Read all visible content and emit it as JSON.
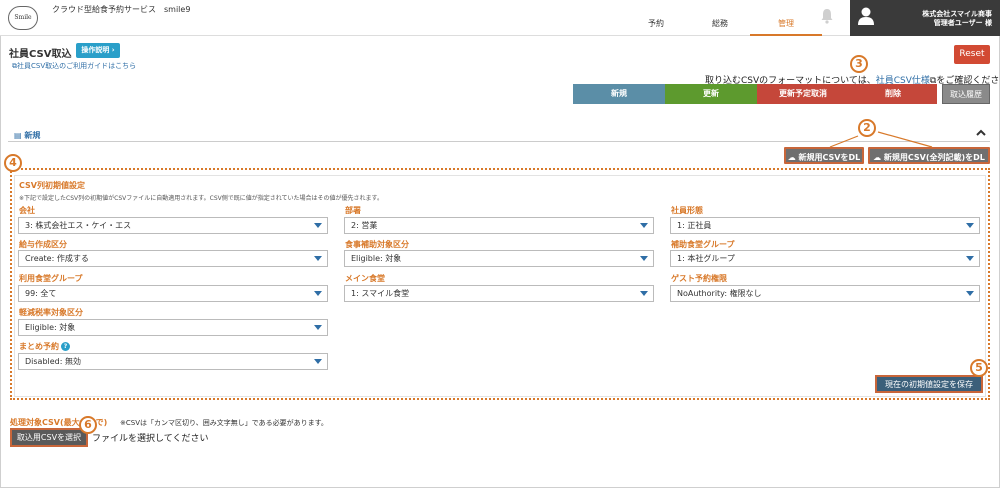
{
  "header": {
    "logo_text": "Smile",
    "service_title": "クラウド型給食予約サービス　smile9",
    "nav": [
      {
        "label": "予約"
      },
      {
        "label": "総務"
      },
      {
        "label": "管理"
      }
    ],
    "company_name": "株式会社スマイル商事",
    "user_name": "管理者ユーザー 様"
  },
  "page": {
    "title": "社員CSV取込",
    "guide_button": "操作説明 ›",
    "guide_link": "社員CSV取込のご利用ガイドはこちら",
    "reset_button": "Reset",
    "format_note_before": "取り込むCSVのフォーマットについては、",
    "format_link": "社員CSV仕様",
    "format_note_after": "をご確認ください",
    "modes": [
      {
        "label": "新規",
        "color": "#5b8ea7"
      },
      {
        "label": "更新",
        "color": "#5d9a2e"
      },
      {
        "label": "更新予定取消",
        "color": "#c5473a"
      },
      {
        "label": "削除",
        "color": "#c5473a"
      }
    ],
    "history_button": "取込履歴",
    "section_label": "新規",
    "dl_new": "新規用CSVをDL",
    "dl_new_full": "新規用CSV(全列記載)をDL"
  },
  "config": {
    "title": "CSV列初期値設定",
    "note": "※下記で設定したCSV列の初期値がCSVファイルに自動適用されます。CSV側で既に値が指定されていた場合はその値が優先されます。",
    "fields": [
      {
        "label": "会社",
        "value": "3: 株式会社エス・ケイ・エス"
      },
      {
        "label": "部署",
        "value": "2: 営業"
      },
      {
        "label": "社員形態",
        "value": "1: 正社員"
      },
      {
        "label": "給与作成区分",
        "value": "Create: 作成する"
      },
      {
        "label": "食事補助対象区分",
        "value": "Eligible: 対象"
      },
      {
        "label": "補助食堂グループ",
        "value": "1: 本社グループ"
      },
      {
        "label": "利用食堂グループ",
        "value": "99: 全て"
      },
      {
        "label": "メイン食堂",
        "value": "1: スマイル食堂"
      },
      {
        "label": "ゲスト予約権限",
        "value": "NoAuthority: 権限なし"
      },
      {
        "label": "軽減税率対象区分",
        "value": "Eligible: 対象"
      },
      {
        "label": "まとめ予約",
        "value": "Disabled: 無効",
        "help": "?"
      }
    ],
    "save_button": "現在の初期値設定を保存"
  },
  "upload": {
    "target_label": "処理対象CSV(最大",
    "target_label_tail": "で)",
    "target_note": "※CSVは「カンマ区切り、囲み文字無し」である必要があります。",
    "file_button": "取込用CSVを選択",
    "file_status": "ファイルを選択してください"
  },
  "markers": [
    "2",
    "3",
    "4",
    "5",
    "6"
  ]
}
